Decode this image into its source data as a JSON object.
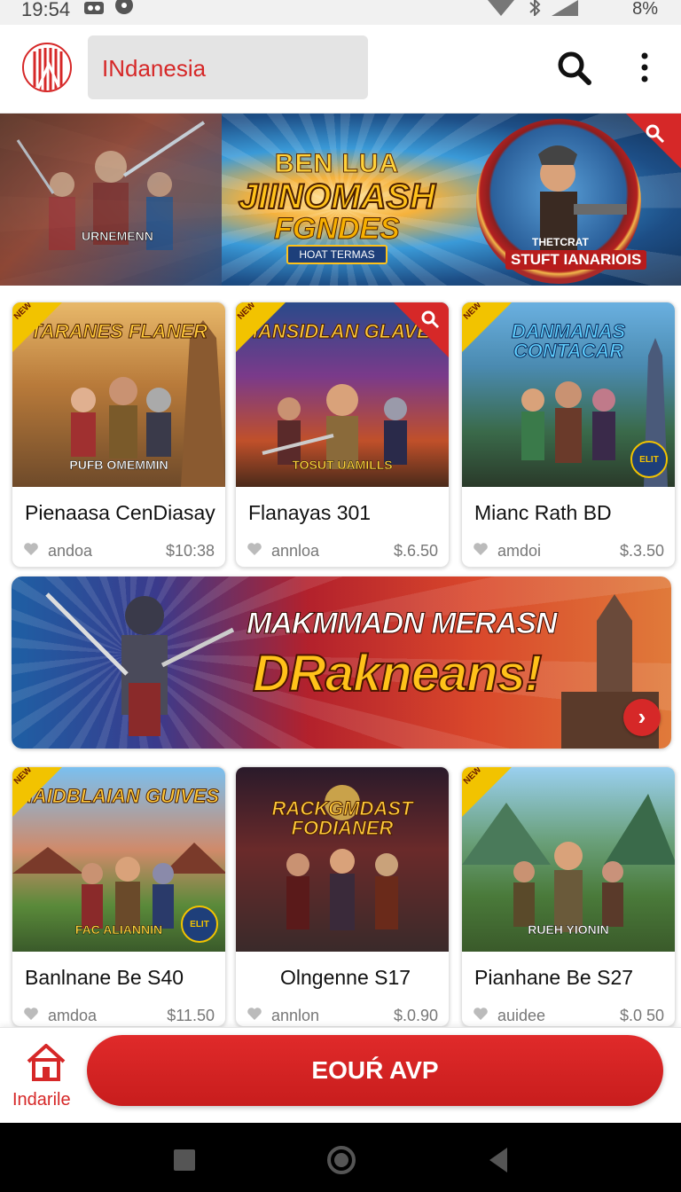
{
  "status_bar": {
    "time": "19:54",
    "battery": "8%"
  },
  "header": {
    "search_value": "INdanesia",
    "accent_color": "#d62828",
    "icons": [
      "brand-logo-icon",
      "search-icon",
      "more-vert-icon"
    ]
  },
  "hero": {
    "title_line1": "BEN LUA",
    "title_line2": "JIINOMASH",
    "title_line3": "FGNDES",
    "subtitle": "HOAT TERMAS",
    "left_label": "URNEMENN",
    "medal_small": "THETCRAT",
    "medal_label": "STUFT IANARIOIS"
  },
  "products_row1": [
    {
      "img_title": "TARANES FLANER",
      "img_caption": "PUFB OMEMMIN",
      "title": "Pienaasa CenDiasay",
      "meta": "andoa",
      "price": "$10:38",
      "ribbon": "NEW"
    },
    {
      "img_title": "MANSIDLAN GLAVES",
      "img_caption": "TOSUT UAMILLS",
      "title": "Flanayas 301",
      "meta": "annloa",
      "price": "$.6.50",
      "ribbon": "NEW"
    },
    {
      "img_title": "DANMANAS CONTACAR",
      "img_caption": "",
      "title": "Mianc Rath BD",
      "meta": "amdoi",
      "price": "$.3.50",
      "ribbon": "NEW",
      "badge": "ELIT"
    }
  ],
  "promo": {
    "line1": "MAKMMADN MERASN",
    "line2": "DRakneans!",
    "next_glyph": "›"
  },
  "products_row2": [
    {
      "img_title": "HAIDBLAIAN GUIVES",
      "img_caption": "FAC ALIANNIN",
      "title": "Banlnane Be S40",
      "meta": "amdoa",
      "price": "$11.50",
      "ribbon": "NEW",
      "badge": "ELIT"
    },
    {
      "img_title": "RACKGMDAST FODIANER",
      "img_caption": "",
      "title": "Olngenne S17",
      "meta": "annlon",
      "price": "$.0.90",
      "ribbon": ""
    },
    {
      "img_title": "",
      "img_caption": "RUEH YIONIN",
      "title": "Pianhane Be S27",
      "meta": "auidee",
      "price": "$.0 50",
      "ribbon": "NEW"
    }
  ],
  "bottom_bar": {
    "home_label": "Indarile",
    "cta_label": "EOUŔ AVP"
  }
}
